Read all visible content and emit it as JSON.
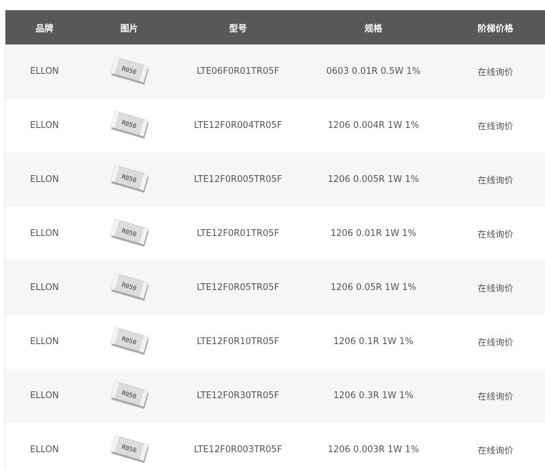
{
  "table": {
    "headers": {
      "brand": "品牌",
      "image": "图片",
      "model": "型号",
      "spec": "规格",
      "price": "阶梯价格"
    },
    "rows": [
      {
        "brand": "ELLON",
        "chip_marking": "R050",
        "model": "LTE06F0R01TR05F",
        "spec": "0603 0.01R 0.5W 1%",
        "price": "在线询价"
      },
      {
        "brand": "ELLON",
        "chip_marking": "R050",
        "model": "LTE12F0R004TR05F",
        "spec": "1206 0.004R 1W 1%",
        "price": "在线询价"
      },
      {
        "brand": "ELLON",
        "chip_marking": "R050",
        "model": "LTE12F0R005TR05F",
        "spec": "1206 0.005R 1W 1%",
        "price": "在线询价"
      },
      {
        "brand": "ELLON",
        "chip_marking": "R050",
        "model": "LTE12F0R01TR05F",
        "spec": "1206 0.01R 1W 1%",
        "price": "在线询价"
      },
      {
        "brand": "ELLON",
        "chip_marking": "R050",
        "model": "LTE12F0R05TR05F",
        "spec": "1206 0.05R 1W 1%",
        "price": "在线询价"
      },
      {
        "brand": "ELLON",
        "chip_marking": "R050",
        "model": "LTE12F0R10TR05F",
        "spec": "1206 0.1R 1W 1%",
        "price": "在线询价"
      },
      {
        "brand": "ELLON",
        "chip_marking": "R050",
        "model": "LTE12F0R30TR05F",
        "spec": "1206 0.3R 1W 1%",
        "price": "在线询价"
      },
      {
        "brand": "ELLON",
        "chip_marking": "R050",
        "model": "LTE12F0R003TR05F",
        "spec": "1206 0.003R 1W 1%",
        "price": "在线询价"
      }
    ]
  },
  "colors": {
    "header_bg": "#595757",
    "header_text": "#ffffff",
    "row_alt_bg": "#f6f6f6",
    "cell_text": "#555555"
  }
}
